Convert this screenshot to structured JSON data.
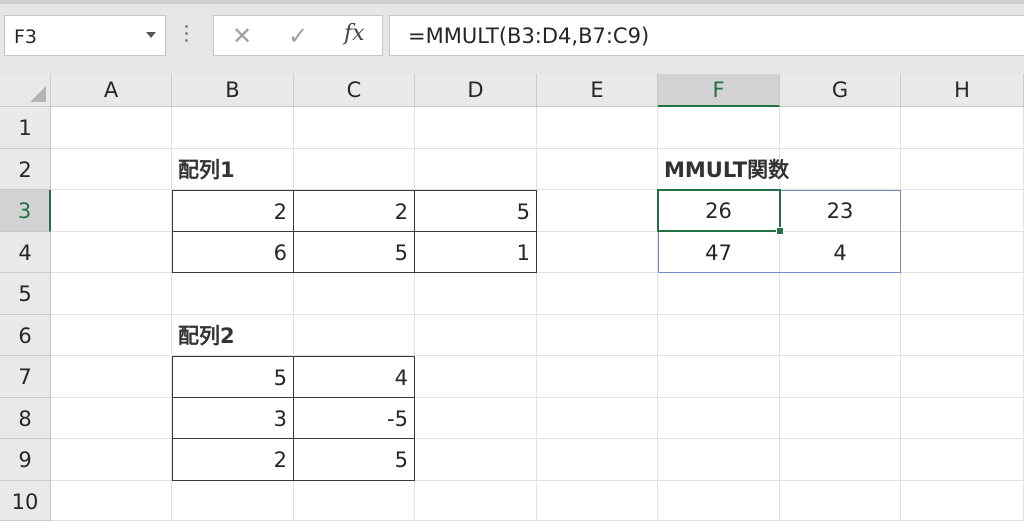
{
  "formula_bar": {
    "name_box": "F3",
    "cancel_glyph": "✕",
    "enter_glyph": "✓",
    "fx_label": "fx",
    "formula": "=MMULT(B3:D4,B7:C9)"
  },
  "columns": [
    "A",
    "B",
    "C",
    "D",
    "E",
    "F",
    "G",
    "H"
  ],
  "rows": [
    "1",
    "2",
    "3",
    "4",
    "5",
    "6",
    "7",
    "8",
    "9",
    "10"
  ],
  "selected": {
    "column": "F",
    "row": "3"
  },
  "cells": {
    "B2": "配列1",
    "F2": "MMULT関数",
    "B3": "2",
    "C3": "2",
    "D3": "5",
    "F3": "26",
    "G3": "23",
    "B4": "6",
    "C4": "5",
    "D4": "1",
    "F4": "47",
    "G4": "4",
    "B6": "配列2",
    "B7": "5",
    "C7": "4",
    "B8": "3",
    "C8": "-5",
    "B9": "2",
    "C9": "5"
  },
  "colors": {
    "accent": "#217346",
    "spill_border": "#6e8fc7"
  }
}
